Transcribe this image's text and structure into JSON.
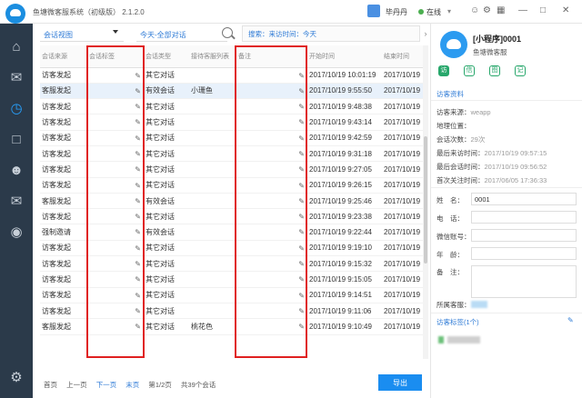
{
  "app": {
    "title": "鱼塘微客服系统（初级版） 2.1.2.0",
    "user_name": "毕丹丹",
    "status": "在线",
    "status_caret": "▾"
  },
  "titlebar_icons": [
    "user-icon",
    "settings-icon",
    "minimize-icon",
    "maximize-icon",
    "close-icon"
  ],
  "toolbar": {
    "view_select": "会话视图",
    "range_select": "今天-全部对话",
    "filter_text": "搜索：来访时间：今天",
    "scroll_right": "›"
  },
  "table": {
    "headers": [
      "会话来源",
      "会话标签",
      "会话类型",
      "接待客服列表",
      "备注",
      "开始时间",
      "结束时间"
    ],
    "pencil": "✎",
    "rows": [
      {
        "source": "访客发起",
        "type": "其它对话",
        "agent": "",
        "start": "2017/10/19 10:01:19",
        "end": "2017/10/19",
        "selected": false
      },
      {
        "source": "客服发起",
        "type": "有效会话",
        "agent": "小珊鱼",
        "start": "2017/10/19 9:55:50",
        "end": "2017/10/19",
        "selected": true
      },
      {
        "source": "访客发起",
        "type": "其它对话",
        "agent": "",
        "start": "2017/10/19 9:48:38",
        "end": "2017/10/19",
        "selected": false
      },
      {
        "source": "访客发起",
        "type": "其它对话",
        "agent": "",
        "start": "2017/10/19 9:43:14",
        "end": "2017/10/19",
        "selected": false
      },
      {
        "source": "访客发起",
        "type": "其它对话",
        "agent": "",
        "start": "2017/10/19 9:42:59",
        "end": "2017/10/19",
        "selected": false
      },
      {
        "source": "访客发起",
        "type": "其它对话",
        "agent": "",
        "start": "2017/10/19 9:31:18",
        "end": "2017/10/19",
        "selected": false
      },
      {
        "source": "访客发起",
        "type": "其它对话",
        "agent": "",
        "start": "2017/10/19 9:27:05",
        "end": "2017/10/19",
        "selected": false
      },
      {
        "source": "访客发起",
        "type": "其它对话",
        "agent": "",
        "start": "2017/10/19 9:26:15",
        "end": "2017/10/19",
        "selected": false
      },
      {
        "source": "客服发起",
        "type": "有效会话",
        "agent": "",
        "start": "2017/10/19 9:25:46",
        "end": "2017/10/19",
        "selected": false
      },
      {
        "source": "访客发起",
        "type": "其它对话",
        "agent": "",
        "start": "2017/10/19 9:23:38",
        "end": "2017/10/19",
        "selected": false
      },
      {
        "source": "强制邀请",
        "type": "有效会话",
        "agent": "",
        "start": "2017/10/19 9:22:44",
        "end": "2017/10/19",
        "selected": false
      },
      {
        "source": "访客发起",
        "type": "其它对话",
        "agent": "",
        "start": "2017/10/19 9:19:10",
        "end": "2017/10/19",
        "selected": false
      },
      {
        "source": "访客发起",
        "type": "其它对话",
        "agent": "",
        "start": "2017/10/19 9:15:32",
        "end": "2017/10/19",
        "selected": false
      },
      {
        "source": "访客发起",
        "type": "其它对话",
        "agent": "",
        "start": "2017/10/19 9:15:05",
        "end": "2017/10/19",
        "selected": false
      },
      {
        "source": "访客发起",
        "type": "其它对话",
        "agent": "",
        "start": "2017/10/19 9:14:51",
        "end": "2017/10/19",
        "selected": false
      },
      {
        "source": "访客发起",
        "type": "其它对话",
        "agent": "",
        "start": "2017/10/19 9:11:06",
        "end": "2017/10/19",
        "selected": false
      },
      {
        "source": "客服发起",
        "type": "其它对话",
        "agent": "桃花色",
        "start": "2017/10/19 9:10:49",
        "end": "2017/10/19",
        "selected": false
      }
    ]
  },
  "pager": {
    "first": "首页",
    "prev": "上一页",
    "next": "下一页",
    "last": "末页",
    "info": "第1/2页",
    "total": "共39个会话"
  },
  "export_label": "导出",
  "right_panel": {
    "name": "[小程序]0001",
    "sub": "鱼塘微客服",
    "tabs": [
      "访",
      "信",
      "图",
      "记"
    ],
    "section_title": "访客资料",
    "info": [
      {
        "k": "访客来源：",
        "v": "weapp"
      },
      {
        "k": "地理位置：",
        "v": ""
      },
      {
        "k": "会话次数：",
        "v": "29次"
      },
      {
        "k": "最后来访时间：",
        "v": "2017/10/19 09:57:15"
      },
      {
        "k": "最后会话时间：",
        "v": "2017/10/19 09:56:52"
      },
      {
        "k": "首次关注时间：",
        "v": "2017/06/05 17:36:33"
      }
    ],
    "form": {
      "name_label": "姓　名：",
      "name_value": "0001",
      "phone_label": "电　话：",
      "wechat_label": "微信账号：",
      "age_label": "年　龄：",
      "note_label": "备　注："
    },
    "group_label": "所属客服：",
    "tag_section": "访客标签(1个)"
  },
  "colors": {
    "accent": "#1a8df0",
    "sidebar": "#2b3a4a",
    "highlight": "#e02020"
  }
}
